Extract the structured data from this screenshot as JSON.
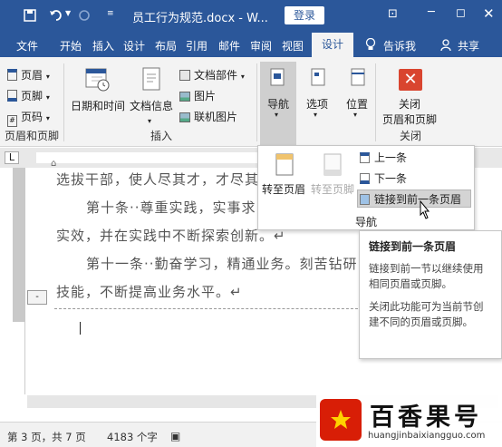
{
  "titlebar": {
    "doc_title": "员工行为规范.docx - W...",
    "login_label": "登录",
    "save_icon": "save-icon",
    "undo_icon": "undo-icon",
    "redo_icon": "redo-icon"
  },
  "tabs": [
    "文件",
    "开始",
    "插入",
    "设计",
    "布局",
    "引用",
    "邮件",
    "审阅",
    "视图"
  ],
  "active_tab": "设计",
  "tell_me": "告诉我",
  "share": "共享",
  "ribbon": {
    "header_label": "页眉",
    "footer_label": "页脚",
    "pagenum_label": "页码",
    "group_header_footer": "页眉和页脚",
    "datetime_label": "日期和时间",
    "docinfo_label": "文档信息",
    "docparts_label": "文档部件",
    "picture_label": "图片",
    "online_picture_label": "联机图片",
    "group_insert": "插入",
    "nav_label": "导航",
    "options_label": "选项",
    "position_label": "位置",
    "close_label_1": "关闭",
    "close_label_2": "页眉和页脚",
    "group_close": "关闭"
  },
  "nav_panel": {
    "goto_header": "转至页眉",
    "goto_footer": "转至页脚",
    "prev": "上一条",
    "next": "下一条",
    "link_prev": "链接到前一条页眉",
    "group": "导航"
  },
  "tooltip": {
    "title": "链接到前一条页眉",
    "desc1": "链接到前一节以继续使用相同页眉或页脚。",
    "desc2": "关闭此功能可为当前节创建不同的页眉或页脚。"
  },
  "document": {
    "line1": "选拔干部，使人尽其才，才尽其",
    "line2": "第十条··尊重实践，实事求",
    "line3": "实效，并在实践中不断探索创新。↵",
    "line4": "第十一条··勤奋学习，精通业务。刻苦钻研",
    "line5": "技能，不断提高业务水平。↵",
    "ruler_tab": "L"
  },
  "status": {
    "page": "第 3 页，共 7 页",
    "words": "4183 个字"
  },
  "watermark": {
    "text": "百香果号",
    "url": "huangjinbaixiangguo.com"
  }
}
